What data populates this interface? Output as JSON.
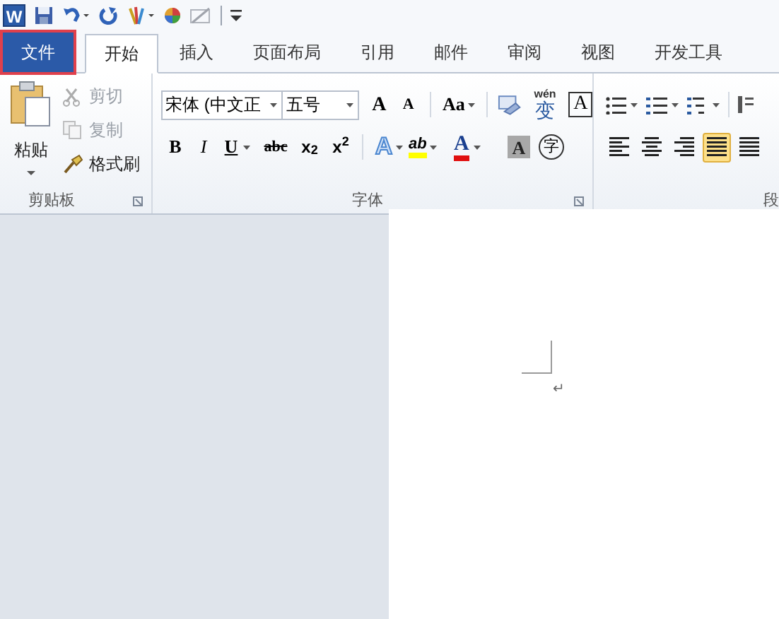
{
  "quick_access": {
    "app_letter": "W"
  },
  "tabs": [
    {
      "label": "文件",
      "selected": false,
      "kind": "file",
      "highlighted": true
    },
    {
      "label": "开始",
      "selected": true,
      "kind": "tab",
      "highlighted": false
    },
    {
      "label": "插入",
      "selected": false,
      "kind": "tab",
      "highlighted": false
    },
    {
      "label": "页面布局",
      "selected": false,
      "kind": "tab",
      "highlighted": false
    },
    {
      "label": "引用",
      "selected": false,
      "kind": "tab",
      "highlighted": false
    },
    {
      "label": "邮件",
      "selected": false,
      "kind": "tab",
      "highlighted": false
    },
    {
      "label": "审阅",
      "selected": false,
      "kind": "tab",
      "highlighted": false
    },
    {
      "label": "视图",
      "selected": false,
      "kind": "tab",
      "highlighted": false
    },
    {
      "label": "开发工具",
      "selected": false,
      "kind": "tab",
      "highlighted": false
    }
  ],
  "clipboard": {
    "paste": "粘贴",
    "commands": [
      {
        "label": "剪切",
        "disabled": true
      },
      {
        "label": "复制",
        "disabled": true
      },
      {
        "label": "格式刷",
        "disabled": false
      }
    ],
    "group_label": "剪贴板"
  },
  "font": {
    "font_name": "宋体 (中文正",
    "font_size": "五号",
    "row1": [
      "A",
      "A",
      "Aa",
      "wén",
      "变",
      "A"
    ],
    "row2": [
      "B",
      "I",
      "U",
      "abc",
      "x$_{2}$",
      "x$^{2}$",
      "A",
      "ab",
      "A",
      "A",
      "字"
    ],
    "group_label": "字体"
  },
  "paragraph": {
    "alignment": [
      {
        "selected": false
      },
      {
        "selected": false
      },
      {
        "selected": false
      },
      {
        "selected": true
      },
      {
        "selected": false
      }
    ],
    "group_label": "段"
  },
  "document": {
    "paragraph_mark": "↵"
  }
}
